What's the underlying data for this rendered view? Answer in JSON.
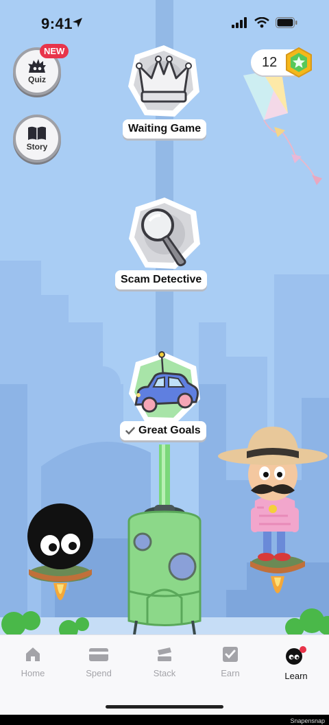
{
  "status_bar": {
    "time": "9:41"
  },
  "side_buttons": {
    "quiz": {
      "label": "Quiz",
      "badge": "NEW"
    },
    "story": {
      "label": "Story"
    }
  },
  "coins": {
    "count": "12"
  },
  "levels": [
    {
      "label": "Waiting Game",
      "icon": "crown-icon",
      "completed": false
    },
    {
      "label": "Scam Detective",
      "icon": "magnifying-glass-icon",
      "completed": false
    },
    {
      "label": "Great Goals",
      "icon": "car-icon",
      "completed": true
    }
  ],
  "tabs": [
    {
      "label": "Home",
      "icon": "home-icon",
      "active": false
    },
    {
      "label": "Spend",
      "icon": "card-icon",
      "active": false
    },
    {
      "label": "Stack",
      "icon": "stack-icon",
      "active": false
    },
    {
      "label": "Earn",
      "icon": "checkbox-icon",
      "active": false
    },
    {
      "label": "Learn",
      "icon": "blob-character-icon",
      "active": true
    }
  ],
  "watermark": "Snapensnap",
  "colors": {
    "sky": "#a9cdf4",
    "badge_red": "#e8344a",
    "tower_green": "#8cd889",
    "tab_active": "#111111",
    "tab_inactive": "#a3a3a8"
  }
}
